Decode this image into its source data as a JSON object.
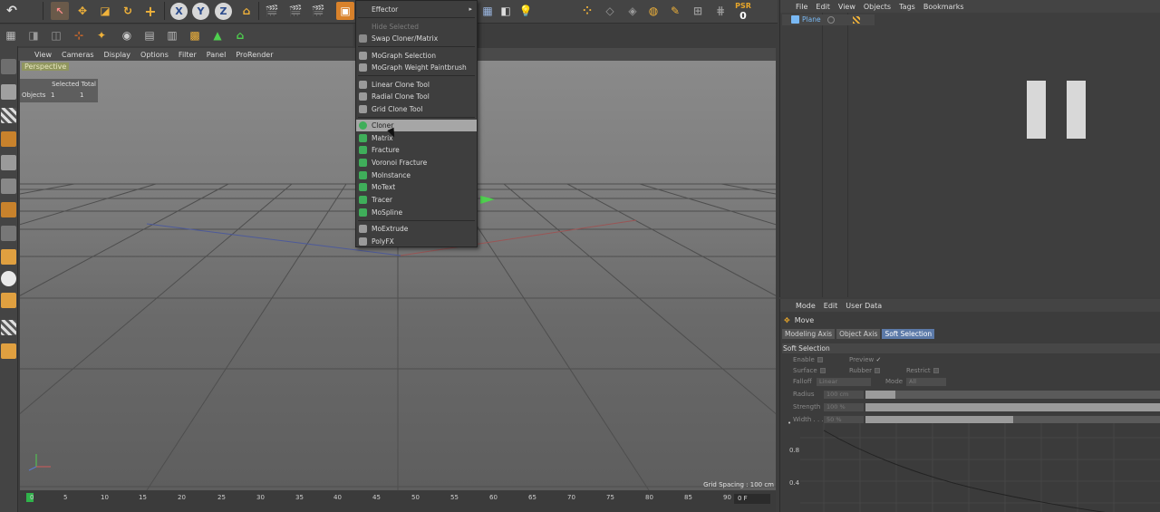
{
  "viewport": {
    "menu": [
      "View",
      "Cameras",
      "Display",
      "Options",
      "Filter",
      "Panel",
      "ProRender"
    ],
    "camera_label": "Perspective",
    "stats": {
      "header": "Selected Total",
      "row_label": "Objects",
      "selected": "1",
      "total": "1"
    },
    "grid_spacing": "Grid Spacing : 100 cm"
  },
  "toolbar": {
    "psr_label": "PSR",
    "psr_value": "0",
    "axes": [
      "X",
      "Y",
      "Z"
    ]
  },
  "timeline": {
    "ticks": [
      "0",
      "5",
      "10",
      "15",
      "20",
      "25",
      "30",
      "35",
      "40",
      "45",
      "50",
      "55",
      "60",
      "65",
      "70",
      "75",
      "80",
      "85",
      "90"
    ],
    "current_frame": "0 F"
  },
  "dropdown": {
    "items": [
      {
        "label": "Effector",
        "icon": "none",
        "state": "submenu"
      },
      {
        "label": "Hide Selected",
        "icon": "hide-icon",
        "state": "disabled"
      },
      {
        "label": "Swap Cloner/Matrix",
        "icon": "swap-icon",
        "state": "normal"
      },
      {
        "label": "MoGraph Selection",
        "icon": "selection-icon",
        "state": "normal"
      },
      {
        "label": "MoGraph Weight Paintbrush",
        "icon": "paintbrush-icon",
        "state": "normal"
      },
      {
        "label": "Linear Clone Tool",
        "icon": "linear-clone-icon",
        "state": "normal"
      },
      {
        "label": "Radial Clone Tool",
        "icon": "radial-clone-icon",
        "state": "normal"
      },
      {
        "label": "Grid Clone Tool",
        "icon": "grid-clone-icon",
        "state": "normal"
      },
      {
        "label": "Cloner",
        "icon": "cloner-icon",
        "state": "highlight"
      },
      {
        "label": "Matrix",
        "icon": "matrix-icon",
        "state": "normal"
      },
      {
        "label": "Fracture",
        "icon": "fracture-icon",
        "state": "normal"
      },
      {
        "label": "Voronoi Fracture",
        "icon": "voronoi-icon",
        "state": "normal"
      },
      {
        "label": "MoInstance",
        "icon": "moinstance-icon",
        "state": "normal"
      },
      {
        "label": "MoText",
        "icon": "motext-icon",
        "state": "normal"
      },
      {
        "label": "Tracer",
        "icon": "tracer-icon",
        "state": "normal"
      },
      {
        "label": "MoSpline",
        "icon": "mospline-icon",
        "state": "normal"
      },
      {
        "label": "MoExtrude",
        "icon": "moextrude-icon",
        "state": "normal"
      },
      {
        "label": "PolyFX",
        "icon": "polyfx-icon",
        "state": "normal"
      }
    ],
    "highlight_color": "#a6a6a6"
  },
  "object_manager": {
    "menu": [
      "File",
      "Edit",
      "View",
      "Objects",
      "Tags",
      "Bookmarks"
    ],
    "objects": [
      {
        "name": "Plane"
      }
    ]
  },
  "attribute_manager": {
    "menu": [
      "Mode",
      "Edit",
      "User Data"
    ],
    "tool_name": "Move",
    "tabs": [
      "Modeling Axis",
      "Object Axis",
      "Soft Selection"
    ],
    "active_tab": "Soft Selection",
    "section": "Soft Selection",
    "labels": {
      "enable": "Enable",
      "preview": "Preview",
      "surface": "Surface",
      "rubber": "Rubber",
      "restrict": "Restrict",
      "falloff": "Falloff",
      "mode": "Mode",
      "radius": "Radius",
      "strength": "Strength",
      "width": "Width . . ."
    },
    "values": {
      "falloff": "Linear",
      "mode": "All",
      "radius": "100 cm",
      "strength": "100 %",
      "width": "50 %",
      "preview_checked": "✓"
    },
    "sliders": {
      "radius": 0.1,
      "strength": 1.0,
      "width": 0.5
    },
    "graph_labels": [
      "0.8",
      "0.4"
    ]
  }
}
